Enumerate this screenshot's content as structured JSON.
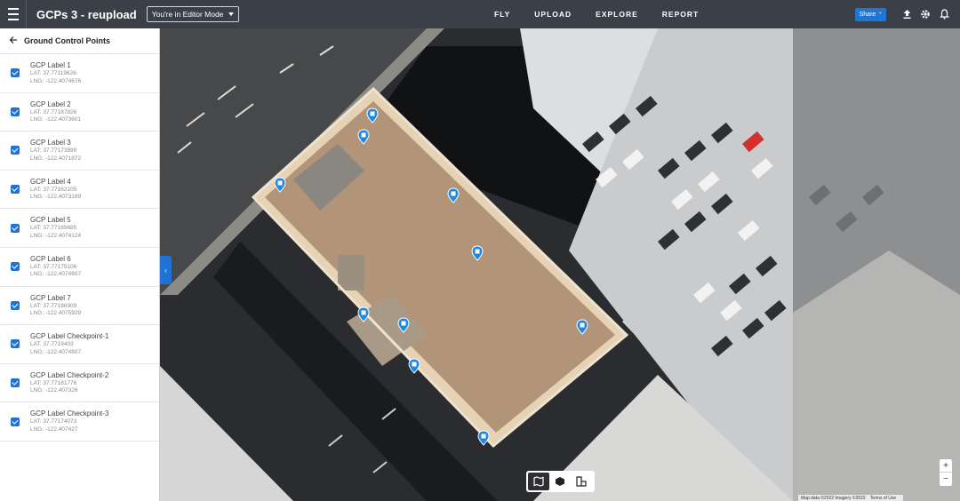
{
  "header": {
    "project_title": "GCPs 3 - reupload",
    "mode_label": "You're in Editor Mode",
    "nav": [
      "FLY",
      "UPLOAD",
      "EXPLORE",
      "REPORT"
    ],
    "share_label": "Share"
  },
  "sidebar": {
    "title": "Ground Control Points",
    "items": [
      {
        "label": "GCP Label 1",
        "lat": "LAT: 37.77119626",
        "lng": "LNG: -122.4074676"
      },
      {
        "label": "GCP Label 2",
        "lat": "LAT: 37.77187826",
        "lng": "LNG: -122.4073601"
      },
      {
        "label": "GCP Label 3",
        "lat": "LAT: 37.77173899",
        "lng": "LNG: -122.4071872"
      },
      {
        "label": "GCP Label 4",
        "lat": "LAT: 37.77162105",
        "lng": "LNG: -122.4073189"
      },
      {
        "label": "GCP Label 5",
        "lat": "LAT: 37.77169685",
        "lng": "LNG: -122.4074124"
      },
      {
        "label": "GCP Label 6",
        "lat": "LAT: 37.77175106",
        "lng": "LNG: -122.4074807"
      },
      {
        "label": "GCP Label 7",
        "lat": "LAT: 37.77186909",
        "lng": "LNG: -122.4075929"
      },
      {
        "label": "GCP Label Checkpoint-1",
        "lat": "LAT: 37.7719403",
        "lng": "LNG: -122.4074807"
      },
      {
        "label": "GCP Label Checkpoint-2",
        "lat": "LAT: 37.77181776",
        "lng": "LNG: -122.407326"
      },
      {
        "label": "GCP Label Checkpoint-3",
        "lat": "LAT: 37.77174073",
        "lng": "LNG: -122.407427"
      }
    ]
  },
  "map": {
    "attribution": [
      "Map data ©2022 Imagery ©2022",
      "Terms of Use"
    ],
    "zoom_in": "+",
    "zoom_out": "−"
  },
  "colors": {
    "accent": "#1f73d6",
    "topbar": "#3b3f47"
  }
}
